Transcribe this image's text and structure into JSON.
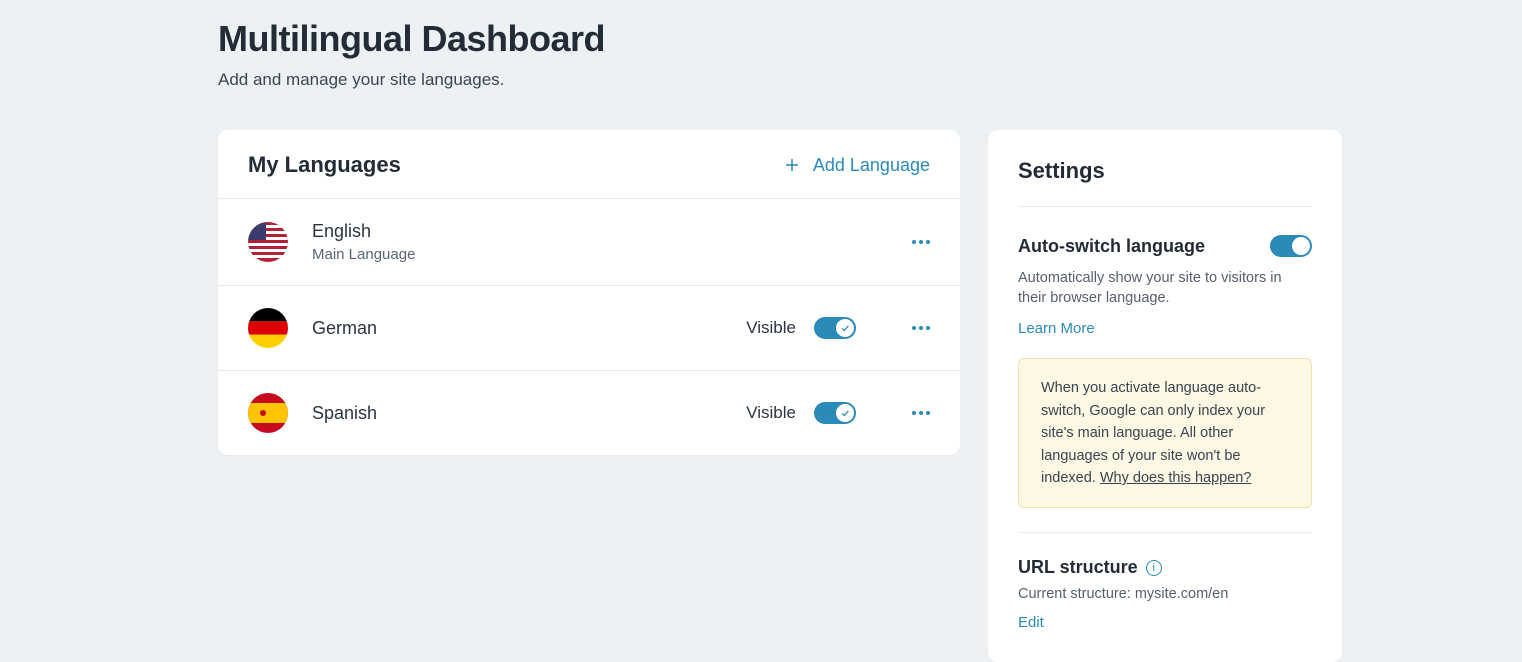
{
  "header": {
    "title": "Multilingual Dashboard",
    "subtitle": "Add and manage your site languages."
  },
  "my_languages": {
    "title": "My Languages",
    "add_label": "Add Language",
    "rows": [
      {
        "name": "English",
        "sub": "Main Language",
        "flag": "us",
        "visible_toggle": false
      },
      {
        "name": "German",
        "sub": "",
        "flag": "de",
        "visible_label": "Visible",
        "visible_toggle": true
      },
      {
        "name": "Spanish",
        "sub": "",
        "flag": "es",
        "visible_label": "Visible",
        "visible_toggle": true
      }
    ]
  },
  "settings": {
    "title": "Settings",
    "auto_switch": {
      "title": "Auto-switch language",
      "desc": "Automatically show your site to visitors in their browser language.",
      "learn_more": "Learn More",
      "on": true
    },
    "notice": {
      "text": "When you activate language auto-switch, Google can only index your site's main language. All other languages of your site won't be indexed. ",
      "link": "Why does this happen?"
    },
    "url": {
      "title": "URL structure",
      "current": "Current structure: mysite.com/en",
      "edit": "Edit"
    }
  }
}
